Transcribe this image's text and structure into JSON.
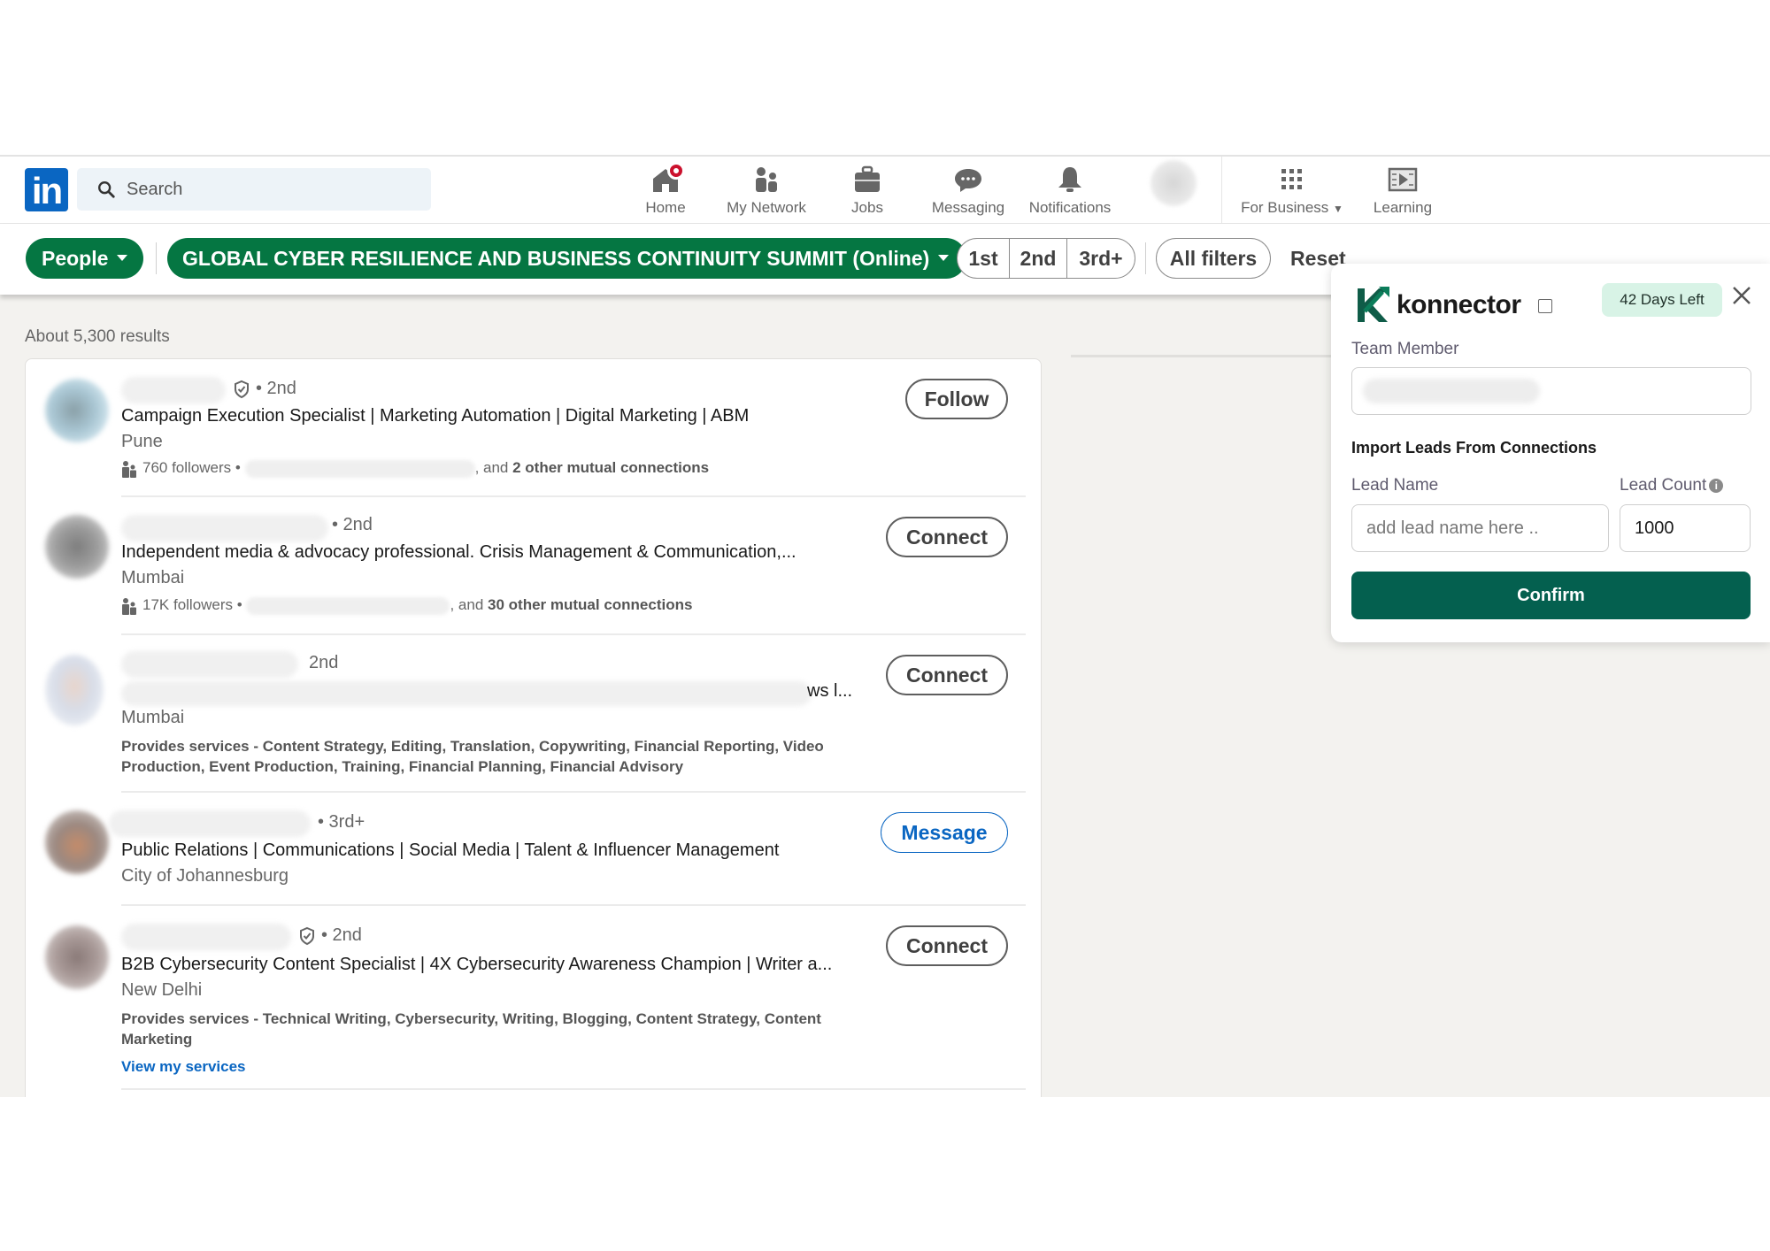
{
  "nav": {
    "logo_text": "in",
    "search_placeholder": "Search",
    "items": [
      {
        "label": "Home",
        "icon": "home-icon",
        "has_notification": true
      },
      {
        "label": "My Network",
        "icon": "network-icon"
      },
      {
        "label": "Jobs",
        "icon": "briefcase-icon"
      },
      {
        "label": "Messaging",
        "icon": "message-icon"
      },
      {
        "label": "Notifications",
        "icon": "bell-icon"
      },
      {
        "label": "For Business",
        "icon": "grid-icon"
      },
      {
        "label": "Learning",
        "icon": "learning-icon"
      }
    ]
  },
  "filters": {
    "type": "People",
    "event": "GLOBAL CYBER RESILIENCE AND BUSINESS CONTINUITY SUMMIT (Online)",
    "degrees": [
      "1st",
      "2nd",
      "3rd+"
    ],
    "all_filters": "All filters",
    "reset": "Reset"
  },
  "results": {
    "count_label": "About 5,300 results",
    "items": [
      {
        "degree": "• 2nd",
        "verified": true,
        "headline": "Campaign Execution Specialist | Marketing Automation | Digital Marketing | ABM",
        "location": "Pune",
        "followers": "760 followers •",
        "mutual": ", and",
        "mutual_bold": "2 other mutual connections",
        "action": "Follow"
      },
      {
        "degree": "• 2nd",
        "verified": false,
        "headline": "Independent media & advocacy professional. Crisis Management & Communication,...",
        "location": "Mumbai",
        "followers": "17K followers •",
        "mutual": ", and",
        "mutual_bold": "30 other mutual connections",
        "action": "Connect"
      },
      {
        "degree": "2nd",
        "verified": false,
        "headline_tail": "ws l...",
        "location": "Mumbai",
        "services": "Provides services - Content Strategy, Editing, Translation, Copywriting, Financial Reporting, Video Production, Event Production, Training, Financial Planning, Financial Advisory",
        "action": "Connect"
      },
      {
        "degree": "• 3rd+",
        "verified": false,
        "headline": "Public Relations | Communications | Social Media | Talent & Influencer Management",
        "location": "City of Johannesburg",
        "action": "Message"
      },
      {
        "degree": "• 2nd",
        "verified": true,
        "headline": "B2B Cybersecurity Content Specialist | 4X Cybersecurity Awareness Champion | Writer a...",
        "location": "New Delhi",
        "services": "Provides services - Technical Writing, Cybersecurity, Writing, Blogging, Content Strategy, Content Marketing",
        "link": "View my services",
        "action": "Connect"
      }
    ]
  },
  "konnector": {
    "title": "konnector",
    "days_left": "42 Days Left",
    "team_member_label": "Team Member",
    "import_heading": "Import Leads From Connections",
    "lead_name_label": "Lead Name",
    "lead_name_placeholder": "add lead name here ..",
    "lead_count_label": "Lead Count",
    "lead_count_value": "1000",
    "info_glyph": "i",
    "confirm_label": "Confirm",
    "colors": {
      "primary": "#04604f",
      "badge_bg": "#d8f3e6"
    }
  },
  "colors": {
    "linkedin_blue": "#0a66c2",
    "filter_green": "#057642",
    "notification_red": "#cb112d"
  }
}
